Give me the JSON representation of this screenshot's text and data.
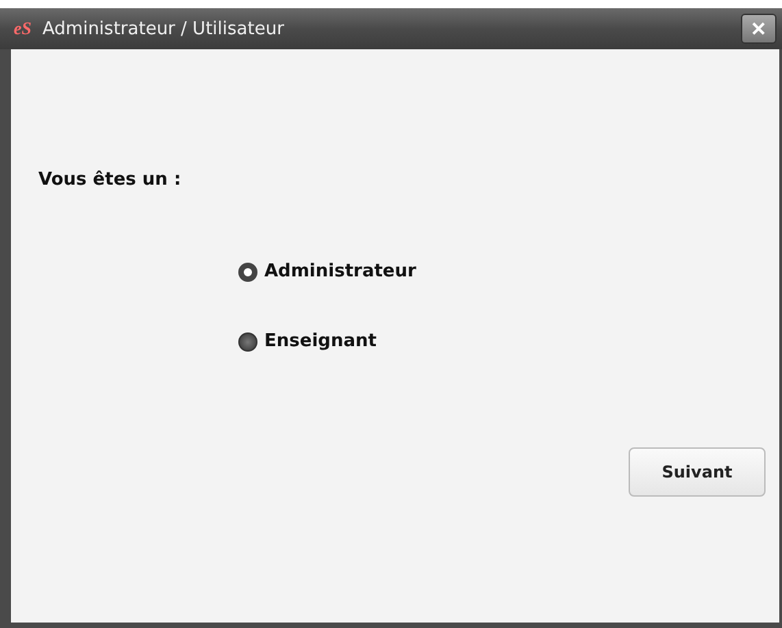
{
  "window": {
    "logo": "eS",
    "title": "Administrateur / Utilisateur",
    "close": "✕"
  },
  "prompt": "Vous êtes un  :",
  "options": [
    {
      "label": "Administrateur",
      "selected": true
    },
    {
      "label": "Enseignant",
      "selected": false
    }
  ],
  "buttons": [
    "Suivant"
  ]
}
